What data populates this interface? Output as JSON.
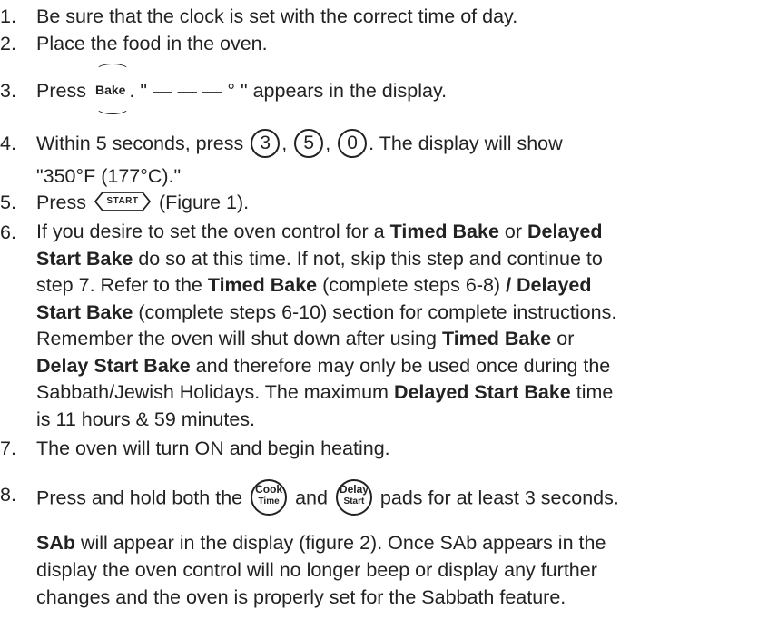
{
  "steps": [
    {
      "num": "1.",
      "text": "Be sure that the clock is set with the correct time of day."
    },
    {
      "num": "2.",
      "text": "Place the food in the oven."
    },
    {
      "num": "3.",
      "pre": "Press",
      "bake_icon": "Bake",
      "post": ". \" — — — ° \" appears in the display."
    },
    {
      "num": "4.",
      "pre": "Within 5 seconds, press",
      "digits": [
        "3",
        "5",
        "0"
      ],
      "post": ". The display will show",
      "line2": "\"350°F (177°C).\""
    },
    {
      "num": "5.",
      "pre": "Press",
      "start_icon": "START",
      "post": "(Figure 1)."
    },
    {
      "num": "6.",
      "l1a": "If you desire to set the oven control for a ",
      "l1b": "Timed Bake",
      "l1c": " or ",
      "l1d": "Delayed",
      "l2a": "Start Bake",
      "l2b": " do so at this time. If not, skip this step and continue to",
      "l3a": "step 7. Refer to the ",
      "l3b": "Timed Bake",
      "l3c": " (complete steps 6-8) ",
      "l3d": "/ Delayed",
      "l4a": "Start Bake",
      "l4b": " (complete steps 6-10) section for complete instructions.",
      "l5a": "Remember the oven will shut down after using ",
      "l5b": "Timed Bake",
      "l5c": " or",
      "l6a": "Delay Start Bake",
      "l6b": " and therefore may only be used once during the",
      "l7a": "Sabbath/Jewish Holidays. The maximum ",
      "l7b": "Delayed Start Bake",
      "l7c": " time",
      "l8": "is 11 hours & 59 minutes."
    },
    {
      "num": "7.",
      "text": "The oven will turn ON and begin heating."
    },
    {
      "num": "8.",
      "pre": "Press and hold both the",
      "mid": "and",
      "post": "pads for at least 3 seconds.",
      "cook_icon": {
        "top": "Cook",
        "bottom": "Time"
      },
      "delay_icon": {
        "top": "Delay",
        "bottom": "Start"
      },
      "p2a": "SAb",
      "p2b": " will appear in the display (figure 2). Once SAb appears in the",
      "p2c": "display the oven control will no longer beep or display any further",
      "p2d": "changes and the oven is properly set for the Sabbath feature."
    }
  ]
}
